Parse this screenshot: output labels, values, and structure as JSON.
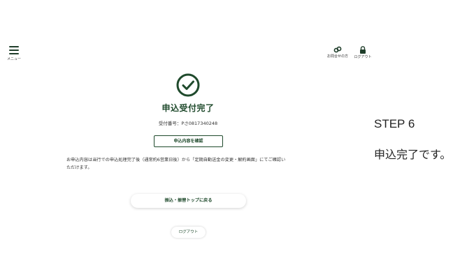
{
  "header": {
    "menu_label": "メニュー",
    "faq_label": "お問合せの方",
    "logout_label": "ログアウト"
  },
  "main": {
    "title": "申込受付完了",
    "receipt_label": "受付番号：",
    "receipt_number": "Pさ0817340248",
    "confirm_button": "申込内容を確認",
    "notice_line1": "お申込内容は当行での申込処理完了後（通常約6営業日後）から「定期自動送金の変更・解約画面」にてご確認い",
    "notice_line2": "ただけます。",
    "top_button": "振込・振替トップに戻る",
    "logout_button": "ログアウト"
  },
  "annotation": {
    "step": "STEP 6",
    "description": "申込完了です。"
  },
  "colors": {
    "brand_green": "#1f4a2c"
  },
  "icons": [
    "menu-icon",
    "faq-icon",
    "lock-icon",
    "check-circle-icon"
  ]
}
